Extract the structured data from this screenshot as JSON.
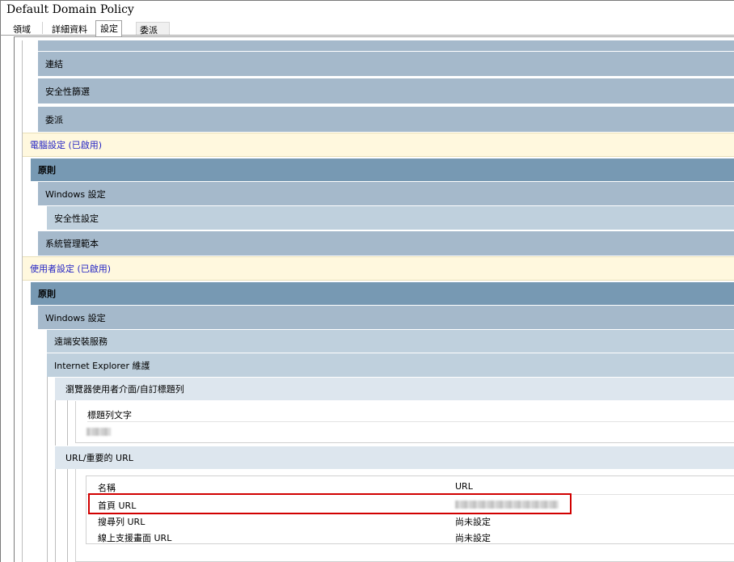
{
  "window": {
    "title": "Default Domain Policy"
  },
  "tabs": [
    {
      "label": "領域"
    },
    {
      "label": "詳細資料"
    },
    {
      "label": "設定"
    },
    {
      "label": "委派"
    }
  ],
  "sections": {
    "links_label": "連結",
    "security_filter_label": "安全性篩選",
    "delegation_label": "委派",
    "computer_config_label": "電腦設定 (已啟用)",
    "computer_policies_label": "原則",
    "computer_windows_settings_label": "Windows 設定",
    "computer_security_settings_label": "安全性設定",
    "computer_admin_templates_label": "系統管理範本",
    "user_config_label": "使用者設定 (已啟用)",
    "user_policies_label": "原則",
    "user_windows_settings_label": "Windows 設定",
    "remote_install_label": "遠端安裝服務",
    "ie_maintenance_label": "Internet Explorer 維護",
    "browser_ui_label": "瀏覽器使用者介面/自訂標題列",
    "titlebar_text_label": "標題列文字",
    "urls_label": "URL/重要的 URL"
  },
  "url_table": {
    "headers": {
      "name": "名稱",
      "url": "URL"
    },
    "rows": [
      {
        "name": "首頁 URL",
        "url": ""
      },
      {
        "name": "搜尋列 URL",
        "url": "尚未設定"
      },
      {
        "name": "線上支援畫面 URL",
        "url": "尚未設定"
      }
    ]
  },
  "colors": {
    "highlight": "#d10000",
    "band_dark": "#7799b3",
    "band_mid": "#a5b9cb",
    "band_light": "#bfd0dd",
    "band_lighter": "#dde6ee",
    "config_banner": "#fff8de",
    "config_text": "#2424c4"
  }
}
